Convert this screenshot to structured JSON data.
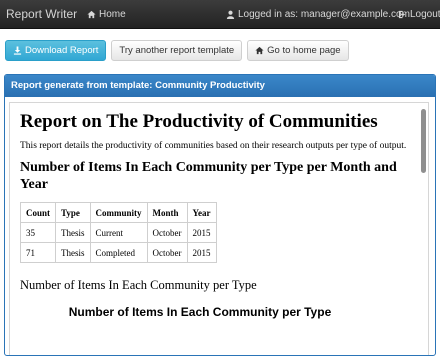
{
  "navbar": {
    "brand": "Report Writer",
    "home_label": "Home",
    "logged_in": "Logged in as: manager@example.com",
    "logout_label": "Logout"
  },
  "actions": {
    "download": "Download Report",
    "try_another": "Try another report template",
    "go_home": "Go to home page"
  },
  "panel": {
    "heading": "Report generate from template: Community Productivity"
  },
  "report": {
    "title": "Report on The Productivity of Communities",
    "intro": "This report details the productivity of communities based on their research outputs per type of output.",
    "section1": "Number of Items In Each Community per Type per Month and Year",
    "table": {
      "headers": [
        "Count",
        "Type",
        "Community",
        "Month",
        "Year"
      ],
      "rows": [
        [
          "35",
          "Thesis",
          "Current",
          "October",
          "2015"
        ],
        [
          "71",
          "Thesis",
          "Completed",
          "October",
          "2015"
        ]
      ]
    },
    "section2": "Number of Items In Each Community per Type",
    "chart_title": "Number of Items In Each Community per Type"
  },
  "colors": {
    "navbar": "#222222",
    "primary": "#31a7d4",
    "panel": "#2a70b2"
  }
}
